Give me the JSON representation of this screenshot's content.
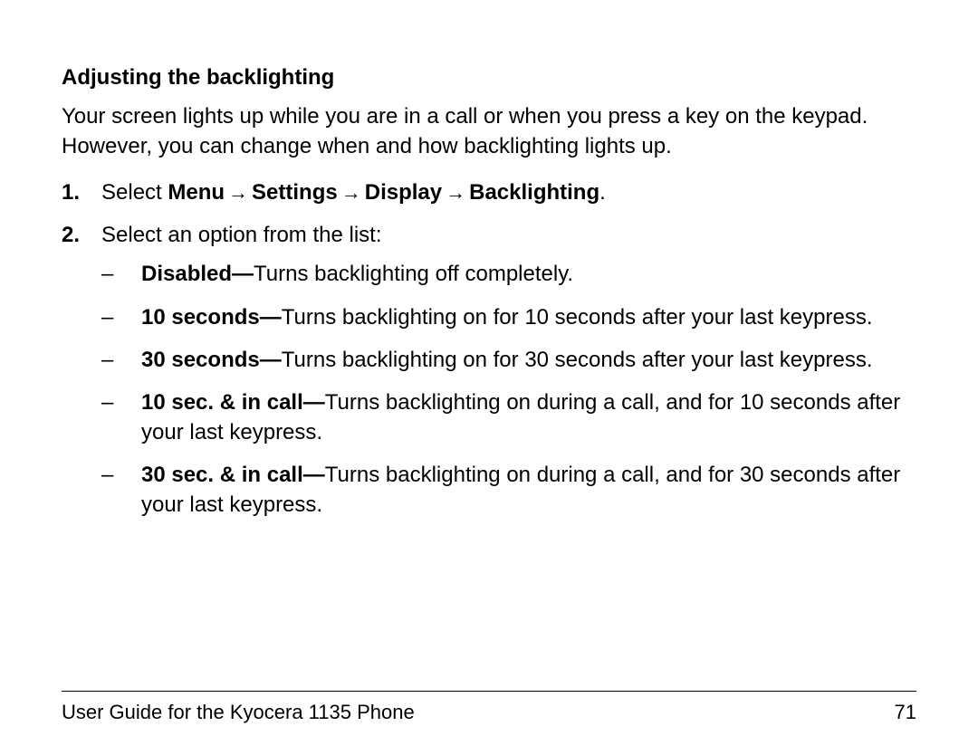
{
  "heading": "Adjusting the backlighting",
  "intro": "Your screen lights up while you are in a call or when you press a key on the keypad. However, you can change when and how backlighting lights up.",
  "step1": {
    "prefix": "Select ",
    "nav": {
      "menu": "Menu",
      "settings": "Settings",
      "display": "Display",
      "backlighting": "Backlighting",
      "arrow": "→"
    },
    "suffix": "."
  },
  "step2": {
    "text": "Select an option from the list:",
    "options": {
      "disabled": {
        "label": "Disabled—",
        "desc": "Turns backlighting off completely."
      },
      "ten": {
        "label": "10 seconds—",
        "desc": "Turns backlighting on for 10 seconds after your last keypress."
      },
      "thirty": {
        "label": "30 seconds—",
        "desc": "Turns backlighting on for 30 seconds after your last keypress."
      },
      "tenInCall": {
        "label": "10 sec. & in call—",
        "desc": "Turns backlighting on during a call, and for 10 seconds after your last keypress."
      },
      "thirtyInCall": {
        "label": "30 sec. & in call—",
        "desc": "Turns backlighting on during a call, and for 30 seconds after your last keypress."
      }
    }
  },
  "footer": {
    "title": "User Guide for the Kyocera 1135 Phone",
    "page": "71"
  },
  "dash": "–"
}
